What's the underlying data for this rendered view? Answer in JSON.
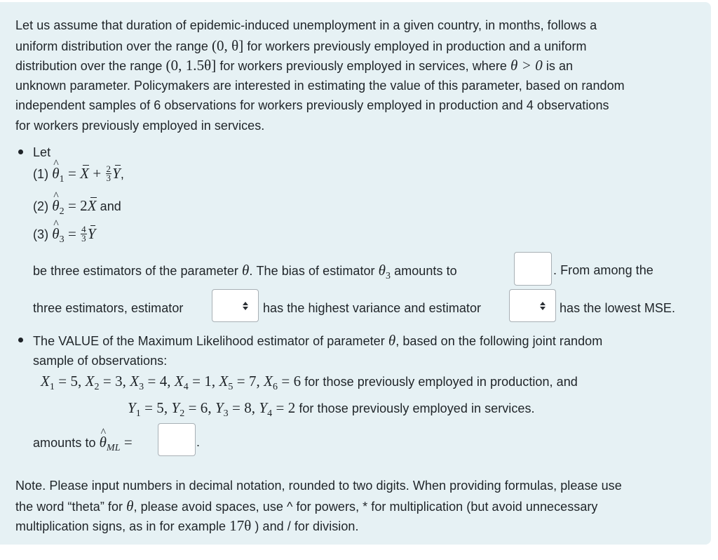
{
  "intro": {
    "lines": [
      "Let us assume that duration of epidemic-induced unemployment in a given country, in months, follows a",
      [
        "uniform distribution over the range ",
        "(0, θ]",
        " for workers previously employed in production and a uniform"
      ],
      [
        "distribution over the range ",
        "(0, 1.5θ]",
        " for workers previously employed in services, where ",
        "θ > 0",
        " is an"
      ],
      "unknown parameter. Policymakers are interested in estimating the value of this parameter, based on random",
      "independent samples of 6 observations for workers previously employed in production and 4 observations",
      "for workers previously employed in services."
    ],
    "line1": "Let us assume that duration of epidemic-induced unemployment in a given country, in months, follows a",
    "line2a": "uniform distribution over the range ",
    "line2m": "(0, θ]",
    "line2b": " for workers previously employed in production and a uniform",
    "line3a": "distribution over the range ",
    "line3m": "(0, 1.5θ]",
    "line3b": " for workers previously employed in services, where ",
    "line3m2": "θ > 0",
    "line3c": " is an",
    "line4": "unknown parameter. Policymakers are interested in estimating the value of this parameter, based on random",
    "line5": "independent samples of 6 observations for workers previously employed in production and 4 observations",
    "line6": "for workers previously employed in services."
  },
  "bullet1": {
    "let": "Let",
    "est1": {
      "label": "(1) ",
      "theta": "θ",
      "sub": "1",
      "eq": " = ",
      "x": "X",
      "plus": " + ",
      "frac_num": "2",
      "frac_den": "3",
      "y": "Y",
      "tail": ","
    },
    "est2": {
      "label": "(2) ",
      "theta": "θ",
      "sub": "2",
      "eq": " = ",
      "coef": "2",
      "x": "X",
      "tail": " and"
    },
    "est3": {
      "label": "(3) ",
      "theta": "θ",
      "sub": "3",
      "eq": " = ",
      "frac_num": "4",
      "frac_den": "3",
      "y": "Y"
    },
    "sentence_a": "be three estimators of the parameter ",
    "theta": "θ",
    "sentence_b": ".  The bias of estimator ",
    "theta3": "θ",
    "theta3_sub": "3",
    "sentence_c": " amounts to",
    "sentence_d": ". From among the",
    "sentence_e": "three estimators, estimator",
    "sentence_f": "has the highest variance and estimator",
    "sentence_g": "has the lowest MSE.",
    "bias_input": {
      "value": "",
      "placeholder": ""
    },
    "highest_variance_select": {
      "selected": ""
    },
    "lowest_mse_select": {
      "selected": ""
    }
  },
  "bullet2": {
    "line1a": "The VALUE of the Maximum Likelihood estimator of parameter ",
    "theta": "θ",
    "line1b": ", based on the following joint random",
    "line2": "sample of observations:",
    "x_obs": [
      {
        "name": "X",
        "sub": "1",
        "value": "5"
      },
      {
        "name": "X",
        "sub": "2",
        "value": "3"
      },
      {
        "name": "X",
        "sub": "3",
        "value": "4"
      },
      {
        "name": "X",
        "sub": "4",
        "value": "1"
      },
      {
        "name": "X",
        "sub": "5",
        "value": "7"
      },
      {
        "name": "X",
        "sub": "6",
        "value": "6"
      }
    ],
    "x_tail": " for those previously employed in production, and",
    "y_obs": [
      {
        "name": "Y",
        "sub": "1",
        "value": "5"
      },
      {
        "name": "Y",
        "sub": "2",
        "value": "6"
      },
      {
        "name": "Y",
        "sub": "3",
        "value": "8"
      },
      {
        "name": "Y",
        "sub": "4",
        "value": "2"
      }
    ],
    "y_tail": " for those previously employed in services.",
    "amounts_to": "amounts to ",
    "ml_theta": "θ",
    "ml_sub": "ML",
    "ml_eq": " =",
    "ml_period": ".",
    "ml_input": {
      "value": "",
      "placeholder": ""
    }
  },
  "note": {
    "line1": "Note. Please input numbers in decimal notation, rounded to two digits. When providing formulas, please use",
    "line2a": "the word “theta” for ",
    "line2m": "θ",
    "line2b": ", please avoid spaces, use ^ for powers, * for multiplication (but avoid unnecessary",
    "line3a": "multiplication signs, as in for example ",
    "line3m": "17θ",
    "line3b": " ) and / for division."
  }
}
